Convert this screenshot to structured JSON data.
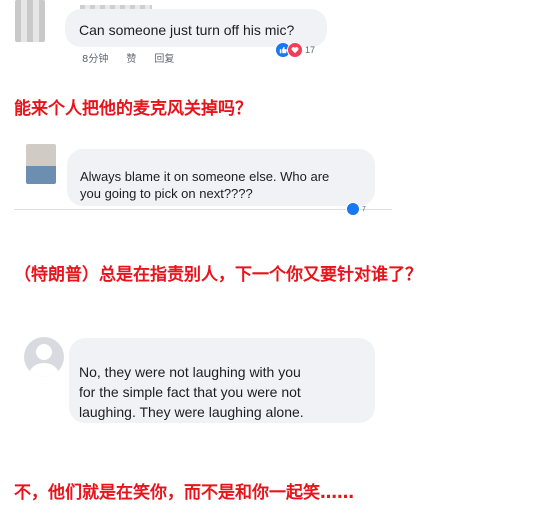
{
  "comment1": {
    "text": "Can someone just turn off his mic?",
    "time": "8分钟",
    "like_label": "赞",
    "reply_label": "回复",
    "reaction_count": "17"
  },
  "caption1": "能来个人把他的麦克风关掉吗？",
  "comment2": {
    "text": "Always blame it on someone else.  Who are\nyou going to pick on next????",
    "reaction_count": "7"
  },
  "caption2": "（特朗普）总是在指责别人，下一个你又要针对谁了？",
  "comment3": {
    "text": "No, they were not laughing with you\nfor the simple fact that you were not\nlaughing. They were laughing alone."
  },
  "caption3": "不，他们就是在笑你，而不是和你一起笑……",
  "colors": {
    "caption": "#e8141b",
    "bubble": "#f1f2f5",
    "like_blue": "#1877f2",
    "love_red": "#f33e58"
  }
}
